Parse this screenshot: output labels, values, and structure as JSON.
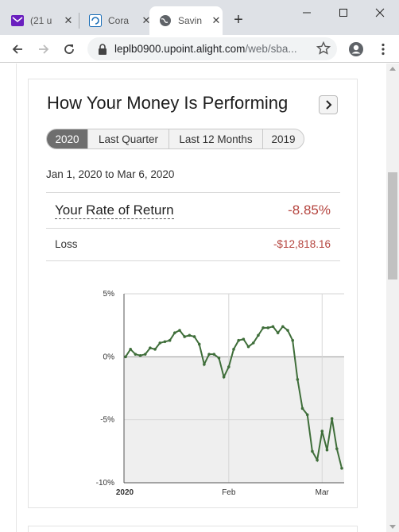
{
  "browser": {
    "tabs": [
      {
        "title": "(21 u",
        "icon": "mail-icon",
        "active": false
      },
      {
        "title": "Cora",
        "icon": "cora-icon",
        "active": false
      },
      {
        "title": "Savin",
        "icon": "globe-icon",
        "active": true
      }
    ],
    "url_host": "leplb0900.upoint.alight.com",
    "url_path": "/web/sba..."
  },
  "widget": {
    "title": "How Your Money Is Performing",
    "periods": [
      "2020",
      "Last Quarter",
      "Last 12 Months",
      "2019"
    ],
    "selected_period": "2020",
    "date_range": "Jan 1, 2020 to Mar 6, 2020",
    "rate_of_return_label": "Your Rate of Return",
    "rate_of_return_value": "-8.85%",
    "loss_label": "Loss",
    "loss_value": "-$12,818.16"
  },
  "colors": {
    "line": "#3f6e3a",
    "negative": "#b5453f",
    "segment_active": "#6e6e6e"
  },
  "chart_data": {
    "type": "line",
    "title": "",
    "xlabel": "",
    "ylabel": "",
    "ylim": [
      -10,
      5
    ],
    "y_ticks": [
      "5%",
      "0%",
      "-5%",
      "-10%"
    ],
    "x_ticks": [
      "2020",
      "Feb",
      "Mar"
    ],
    "grid": true,
    "series": [
      {
        "values": [
          0.0,
          0.6,
          0.2,
          0.1,
          0.2,
          0.7,
          0.6,
          1.1,
          1.2,
          1.3,
          1.9,
          2.1,
          1.6,
          1.7,
          1.6,
          1.0,
          -0.6,
          0.2,
          0.2,
          -0.1,
          -1.6,
          -0.8,
          0.6,
          1.3,
          1.4,
          0.8,
          1.1,
          1.7,
          2.3,
          2.3,
          2.4,
          1.9,
          2.4,
          2.1,
          1.3,
          -1.8,
          -4.1,
          -4.6,
          -7.5,
          -8.2,
          -5.9,
          -7.4,
          -4.9,
          -7.3,
          -8.85
        ]
      }
    ]
  }
}
